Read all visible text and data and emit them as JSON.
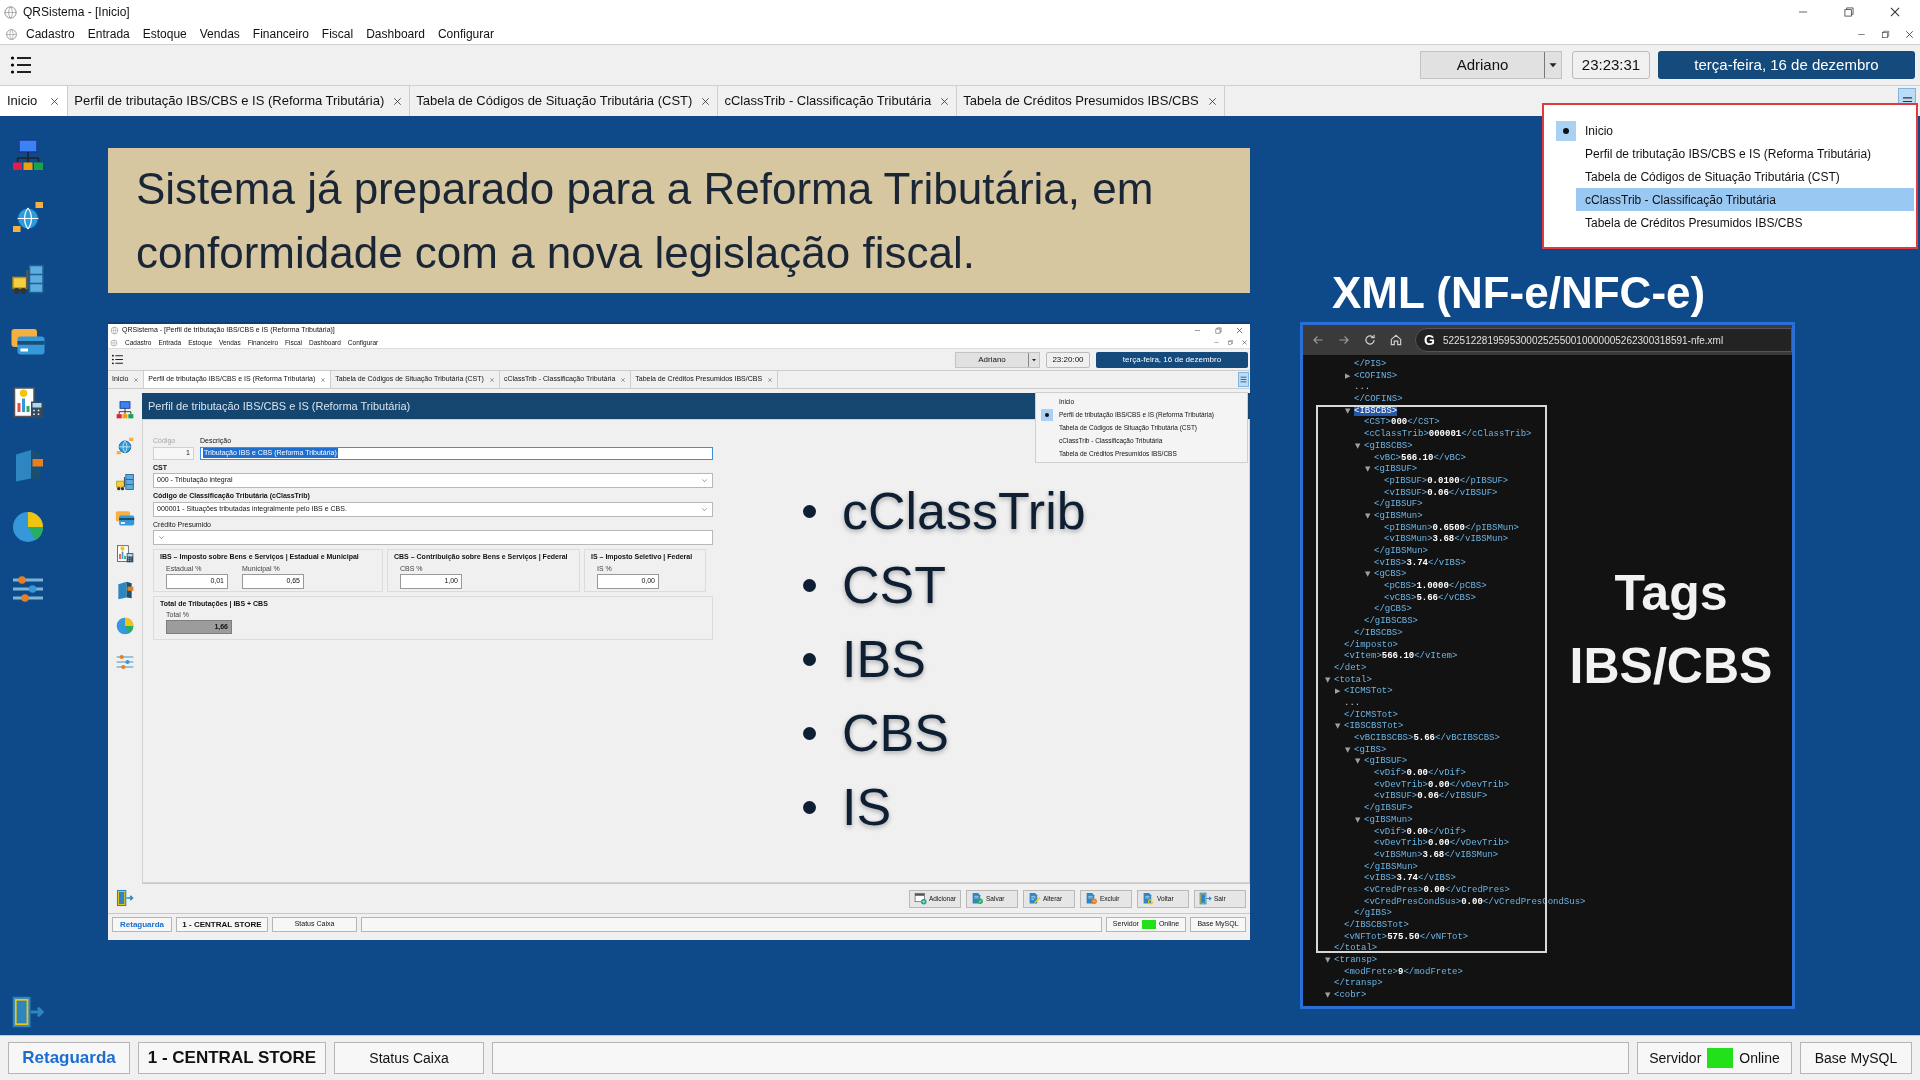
{
  "window": {
    "title": "QRSistema - [Inicio]"
  },
  "menu": [
    "Cadastro",
    "Entrada",
    "Estoque",
    "Vendas",
    "Financeiro",
    "Fiscal",
    "Dashboard",
    "Configurar"
  ],
  "toolbar": {
    "user": "Adriano",
    "time": "23:23:31",
    "date": "terça-feira, 16 de dezembro"
  },
  "tabs": [
    {
      "label": "Inicio",
      "selected": true
    },
    {
      "label": "Perfil de tributação IBS/CBS e IS (Reforma Tributária)",
      "selected": false
    },
    {
      "label": "Tabela de Códigos de Situação Tributária (CST)",
      "selected": false
    },
    {
      "label": "cClassTrib - Classificação Tributária",
      "selected": false
    },
    {
      "label": "Tabela de Créditos Presumidos IBS/CBS",
      "selected": false
    }
  ],
  "tab_list_menu": [
    {
      "label": "Inicio",
      "current": true,
      "selected": false
    },
    {
      "label": "Perfil de tributação IBS/CBS e IS (Reforma Tributária)",
      "current": false,
      "selected": false
    },
    {
      "label": "Tabela de Códigos de Situação Tributária (CST)",
      "current": false,
      "selected": false
    },
    {
      "label": "cClassTrib - Classificação Tributária",
      "current": false,
      "selected": true
    },
    {
      "label": "Tabela de Créditos Presumidos IBS/CBS",
      "current": false,
      "selected": false
    }
  ],
  "banner": {
    "text": "Sistema já preparado para a Reforma Tributária, em conformidade com a nova legislação fiscal."
  },
  "embedded_screenshot": {
    "window_title": "QRSistema - [Perfil de tributação IBS/CBS e IS (Reforma Tributária)]",
    "menu": [
      "Cadastro",
      "Entrada",
      "Estoque",
      "Vendas",
      "Financeiro",
      "Fiscal",
      "Dashboard",
      "Configurar"
    ],
    "toolbar": {
      "user": "Adriano",
      "time": "23:20:00",
      "date": "terça-feira, 16 de dezembro"
    },
    "tabs": [
      {
        "label": "Inicio",
        "selected": false
      },
      {
        "label": "Perfil de tributação IBS/CBS e IS (Reforma Tributária)",
        "selected": true
      },
      {
        "label": "Tabela de Códigos de Situação Tributária (CST)",
        "selected": false
      },
      {
        "label": "cClassTrib - Classificação Tributária",
        "selected": false
      },
      {
        "label": "Tabela de Créditos Presumidos IBS/CBS",
        "selected": false
      }
    ],
    "panel_title": "Perfil de tributação IBS/CBS e IS (Reforma Tributária)",
    "form": {
      "codigo": {
        "label": "Código",
        "value": "1",
        "disabled": true
      },
      "descricao": {
        "label": "Descrição",
        "value": "Tributação IBS e CBS (Reforma Tributária)",
        "text_selected": true
      },
      "cst": {
        "label": "CST",
        "value": "000 - Tributação integral"
      },
      "cclasstrib": {
        "label": "Código de Classificação Tributária (cClassTrib)",
        "value": "000001 - Situações tributadas integralmente pelo IBS e CBS."
      },
      "credito_presumido": {
        "label": "Crédito Presumido"
      },
      "groups": [
        {
          "title": "IBS – Imposto sobre Bens e Serviços | Estadual e Municipal",
          "fields": [
            {
              "label": "Estadual %",
              "value": "0,01"
            },
            {
              "label": "Municipal %",
              "value": "0,65"
            }
          ]
        },
        {
          "title": "CBS – Contribuição sobre Bens e Serviços | Federal",
          "fields": [
            {
              "label": "CBS %",
              "value": "1,00"
            }
          ]
        },
        {
          "title": "IS – Imposto Seletivo | Federal",
          "fields": [
            {
              "label": "IS %",
              "value": "0,00"
            }
          ]
        }
      ],
      "total": {
        "title": "Total de Tributações | IBS + CBS",
        "label": "Total %",
        "value": "1,66"
      }
    },
    "tab_list_menu": [
      {
        "label": "Inicio",
        "current": false
      },
      {
        "label": "Perfil de tributação IBS/CBS e IS (Reforma Tributária)",
        "current": true
      },
      {
        "label": "Tabela de Códigos de Situação Tributária (CST)",
        "current": false
      },
      {
        "label": "cClassTrib - Classificação Tributária",
        "current": false
      },
      {
        "label": "Tabela de Créditos Presumidos IBS/CBS",
        "current": false
      }
    ],
    "buttons": [
      {
        "label": "Adicionar",
        "kind": "add"
      },
      {
        "label": "Salvar",
        "kind": "save"
      },
      {
        "label": "Alterar",
        "kind": "edit"
      },
      {
        "label": "Excluir",
        "kind": "delete"
      },
      {
        "label": "Voltar",
        "kind": "back"
      },
      {
        "label": "Sair",
        "kind": "exit"
      }
    ],
    "status_bar": {
      "module": "Retaguarda",
      "store": "1 - CENTRAL STORE",
      "cash_status": "Status Caixa",
      "server": {
        "label": "Servidor",
        "online": true,
        "status": "Online"
      },
      "database": "Base MySQL"
    }
  },
  "bullets": [
    "cClassTrib",
    "CST",
    "IBS",
    "CBS",
    "IS"
  ],
  "xml_heading": "XML (NF-e/NFC-e)",
  "xml_viewer": {
    "address_icon": "G",
    "address": "52251228195953000252550010000005262300318591-nfe.xml",
    "lines": [
      {
        "children": [
          {
            "children": [
              {
                "tag": "</PIS>"
              },
              {
                "tag": "<COFINS>",
                "toggle": "▶"
              },
              {
                "text": "..."
              },
              {
                "tag": "</COFINS>"
              },
              {
                "tag": "<IBSCBS>",
                "toggle": "▼",
                "highlighted": true,
                "children": [
                  {
                    "tag": "<CST>",
                    "value": "000",
                    "close": "</CST>"
                  },
                  {
                    "tag": "<cClassTrib>",
                    "value": "000001",
                    "close": "</cClassTrib>"
                  },
                  {
                    "tag": "<gIBSCBS>",
                    "toggle": "▼",
                    "children": [
                      {
                        "tag": "<vBC>",
                        "value": "566.10",
                        "close": "</vBC>"
                      },
                      {
                        "tag": "<gIBSUF>",
                        "toggle": "▼",
                        "children": [
                          {
                            "tag": "<pIBSUF>",
                            "value": "0.0100",
                            "close": "</pIBSUF>"
                          },
                          {
                            "tag": "<vIBSUF>",
                            "value": "0.06",
                            "close": "</vIBSUF>"
                          }
                        ]
                      },
                      {
                        "tag": "</gIBSUF>"
                      },
                      {
                        "tag": "<gIBSMun>",
                        "toggle": "▼",
                        "children": [
                          {
                            "tag": "<pIBSMun>",
                            "value": "0.6500",
                            "close": "</pIBSMun>"
                          },
                          {
                            "tag": "<vIBSMun>",
                            "value": "3.68",
                            "close": "</vIBSMun>"
                          }
                        ]
                      },
                      {
                        "tag": "</gIBSMun>"
                      },
                      {
                        "tag": "<vIBS>",
                        "value": "3.74",
                        "close": "</vIBS>"
                      },
                      {
                        "tag": "<gCBS>",
                        "toggle": "▼",
                        "children": [
                          {
                            "tag": "<pCBS>",
                            "value": "1.0000",
                            "close": "</pCBS>"
                          },
                          {
                            "tag": "<vCBS>",
                            "value": "5.66",
                            "close": "</vCBS>"
                          }
                        ]
                      },
                      {
                        "tag": "</gCBS>"
                      }
                    ]
                  },
                  {
                    "tag": "</gIBSCBS>"
                  }
                ]
              },
              {
                "tag": "</IBSCBS>"
              }
            ]
          },
          {
            "tag": "</imposto>"
          },
          {
            "tag": "<vItem>",
            "value": "566.10",
            "close": "</vItem>"
          }
        ]
      },
      {
        "tag": "</det>"
      },
      {
        "tag": "<total>",
        "toggle": "▼",
        "children": [
          {
            "tag": "<ICMSTot>",
            "toggle": "▶"
          },
          {
            "text": "..."
          },
          {
            "tag": "</ICMSTot>"
          },
          {
            "tag": "<IBSCBSTot>",
            "toggle": "▼",
            "children": [
              {
                "tag": "<vBCIBSCBS>",
                "value": "5.66",
                "close": "</vBCIBSCBS>"
              },
              {
                "tag": "<gIBS>",
                "toggle": "▼",
                "children": [
                  {
                    "tag": "<gIBSUF>",
                    "toggle": "▼",
                    "children": [
                      {
                        "tag": "<vDif>",
                        "value": "0.00",
                        "close": "</vDif>"
                      },
                      {
                        "tag": "<vDevTrib>",
                        "value": "0.00",
                        "close": "</vDevTrib>"
                      },
                      {
                        "tag": "<vIBSUF>",
                        "value": "0.06",
                        "close": "</vIBSUF>"
                      }
                    ]
                  },
                  {
                    "tag": "</gIBSUF>"
                  },
                  {
                    "tag": "<gIBSMun>",
                    "toggle": "▼",
                    "children": [
                      {
                        "tag": "<vDif>",
                        "value": "0.00",
                        "close": "</vDif>"
                      },
                      {
                        "tag": "<vDevTrib>",
                        "value": "0.00",
                        "close": "</vDevTrib>"
                      },
                      {
                        "tag": "<vIBSMun>",
                        "value": "3.68",
                        "close": "</vIBSMun>"
                      }
                    ]
                  },
                  {
                    "tag": "</gIBSMun>"
                  },
                  {
                    "tag": "<vIBS>",
                    "value": "3.74",
                    "close": "</vIBS>"
                  },
                  {
                    "tag": "<vCredPres>",
                    "value": "0.00",
                    "close": "</vCredPres>"
                  },
                  {
                    "tag": "<vCredPresCondSus>",
                    "value": "0.00",
                    "close": "</vCredPresCondSus>"
                  }
                ]
              },
              {
                "tag": "</gIBS>"
              }
            ]
          },
          {
            "tag": "</IBSCBSTot>"
          },
          {
            "tag": "<vNFTot>",
            "value": "575.50",
            "close": "</vNFTot>"
          }
        ]
      },
      {
        "tag": "</total>"
      },
      {
        "tag": "<transp>",
        "toggle": "▼",
        "children": [
          {
            "tag": "<modFrete>",
            "value": "9",
            "close": "</modFrete>"
          }
        ]
      },
      {
        "tag": "</transp>"
      },
      {
        "tag": "<cobr>",
        "toggle": "▼"
      }
    ]
  },
  "xml_caption": "Tags IBS/CBS",
  "status_bar": {
    "module": "Retaguarda",
    "store": "1 - CENTRAL STORE",
    "cash_status": "Status Caixa",
    "server": {
      "label": "Servidor",
      "online": true,
      "status": "Online"
    },
    "database": "Base MySQL"
  }
}
